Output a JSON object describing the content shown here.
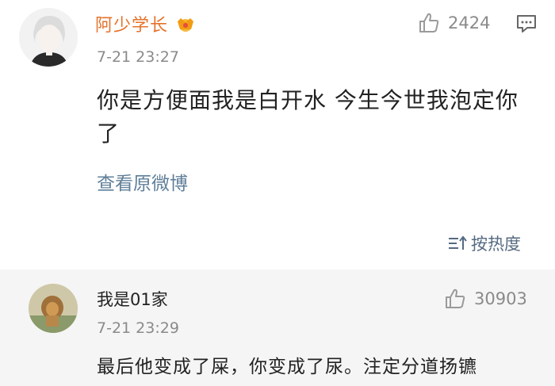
{
  "main_comment": {
    "author": "阿少学长",
    "badge_icon": "crown-icon",
    "time": "7-21 23:27",
    "likes": "2424",
    "text": "你是方便面我是白开水  今生今世我泡定你了",
    "view_original": "查看原微博"
  },
  "sort": {
    "label": "按热度",
    "icon": "sort-icon"
  },
  "reply": {
    "author": "我是01家",
    "time": "7-21 23:29",
    "likes": "30903",
    "text": "最后他变成了屎，你变成了尿。注定分道扬镳"
  },
  "colors": {
    "author_name": "#e5722a",
    "link": "#5f7f99",
    "muted": "#8a8a8a",
    "reply_bg": "#f5f5f5"
  }
}
